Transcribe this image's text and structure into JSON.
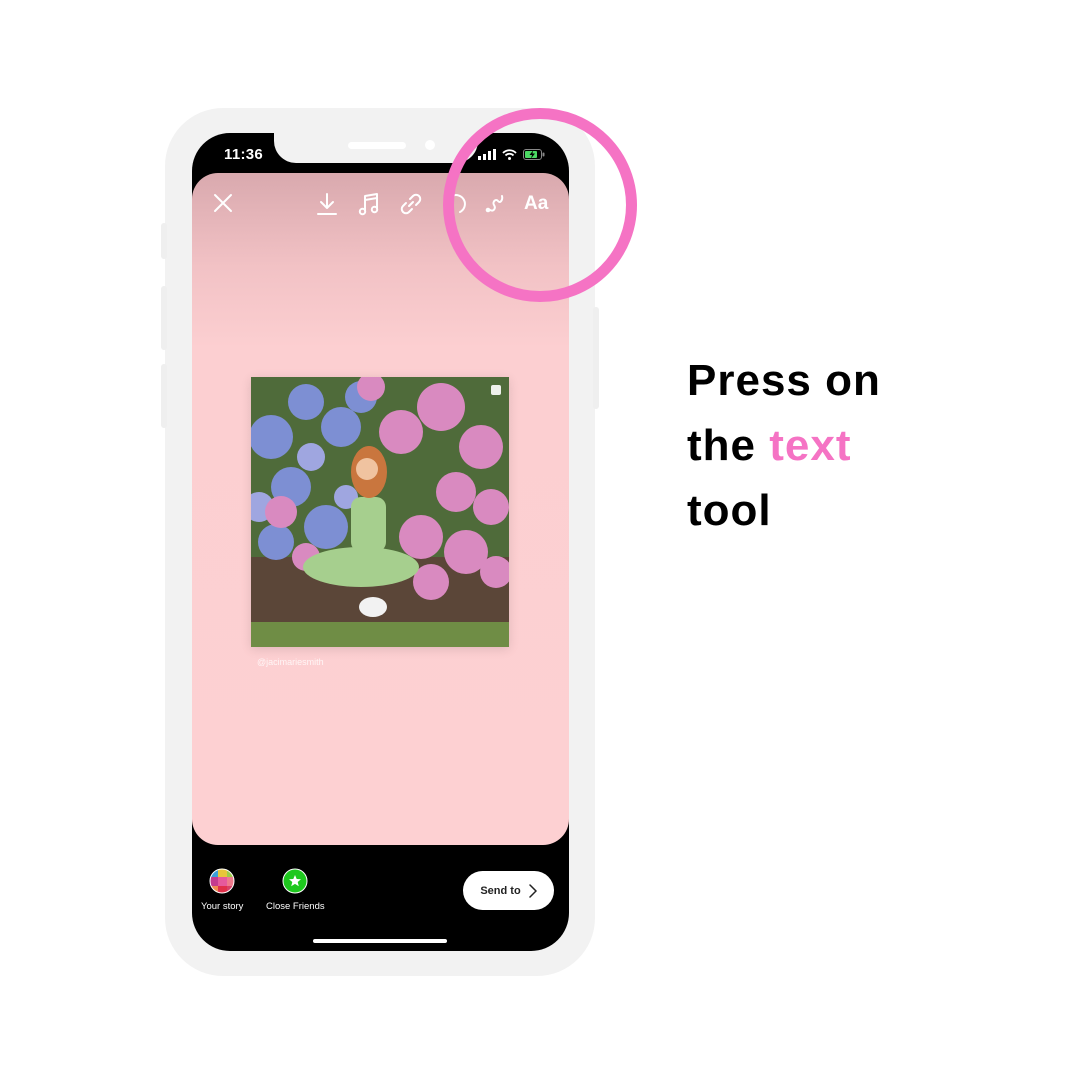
{
  "status_bar": {
    "time": "11:36",
    "icons": [
      "signal-icon",
      "wifi-icon",
      "battery-charging-icon"
    ]
  },
  "story_editor": {
    "toolbar": {
      "close": "close-icon",
      "download": "download-icon",
      "music": "music-icon",
      "link": "link-icon",
      "sticker": "sticker-icon",
      "draw": "draw-icon",
      "text_tool_label": "Aa"
    },
    "canvas_color": "#fdd0d2",
    "post": {
      "image_description": "Woman in green outfit sitting in front of hydrangea bushes, making a peace sign",
      "credit": "@jacimariesmith"
    }
  },
  "share_bar": {
    "your_story_label": "Your story",
    "close_friends_label": "Close Friends",
    "send_to_label": "Send to"
  },
  "instruction": {
    "line1": "Press on",
    "line2_prefix": "the ",
    "line2_highlight": "text",
    "line3": "tool",
    "accent_color": "#f573c4"
  }
}
